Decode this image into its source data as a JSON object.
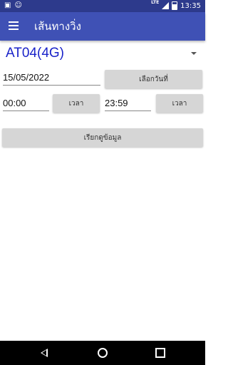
{
  "status_bar": {
    "notification_icons": [
      "image-notification-icon",
      "android-notification-icon"
    ],
    "network_label": "LTE",
    "time": "13:35"
  },
  "app_bar": {
    "title": "เส้นทางวิ่ง"
  },
  "vehicle_select": {
    "value": "AT04(4G)"
  },
  "date_row": {
    "date_value": "15/05/2022",
    "select_date_label": "เลือกวันที่"
  },
  "time_row": {
    "start_time": "00:00",
    "start_time_button": "เวลา",
    "end_time": "23:59",
    "end_time_button": "เวลา"
  },
  "fetch_button": {
    "label": "เรียกดูข้อมูล"
  },
  "colors": {
    "status_bar": "#2d3a8c",
    "app_bar": "#3f51b5",
    "spinner_text": "#1a23c9",
    "button_bg": "#d6d6d6"
  }
}
